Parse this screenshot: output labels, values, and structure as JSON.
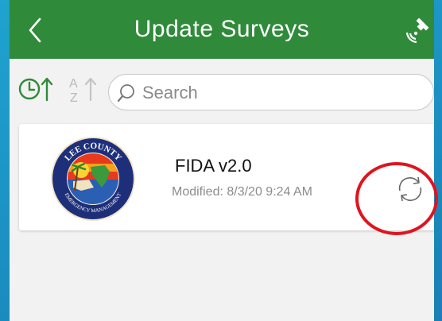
{
  "header": {
    "title": "Update Surveys",
    "back_icon": "chevron-left-icon",
    "gps_icon": "satellite-icon",
    "color": "#2f8a3a"
  },
  "toolbar": {
    "sort_time_icon": "clock-sort-icon",
    "sort_alpha_icon": "alpha-sort-icon",
    "sort_active_color": "#2f8a3a",
    "search": {
      "placeholder": "Search",
      "value": ""
    }
  },
  "surveys": [
    {
      "name": "FIDA v2.0",
      "modified": "Modified: 8/3/20 9:24 AM",
      "logo": {
        "top_text": "LEE COUNTY",
        "bottom_text": "EMERGENCY MANAGEMENT"
      },
      "action_icon": "refresh-icon"
    }
  ],
  "annotation": {
    "highlight_color": "#e0141e"
  }
}
